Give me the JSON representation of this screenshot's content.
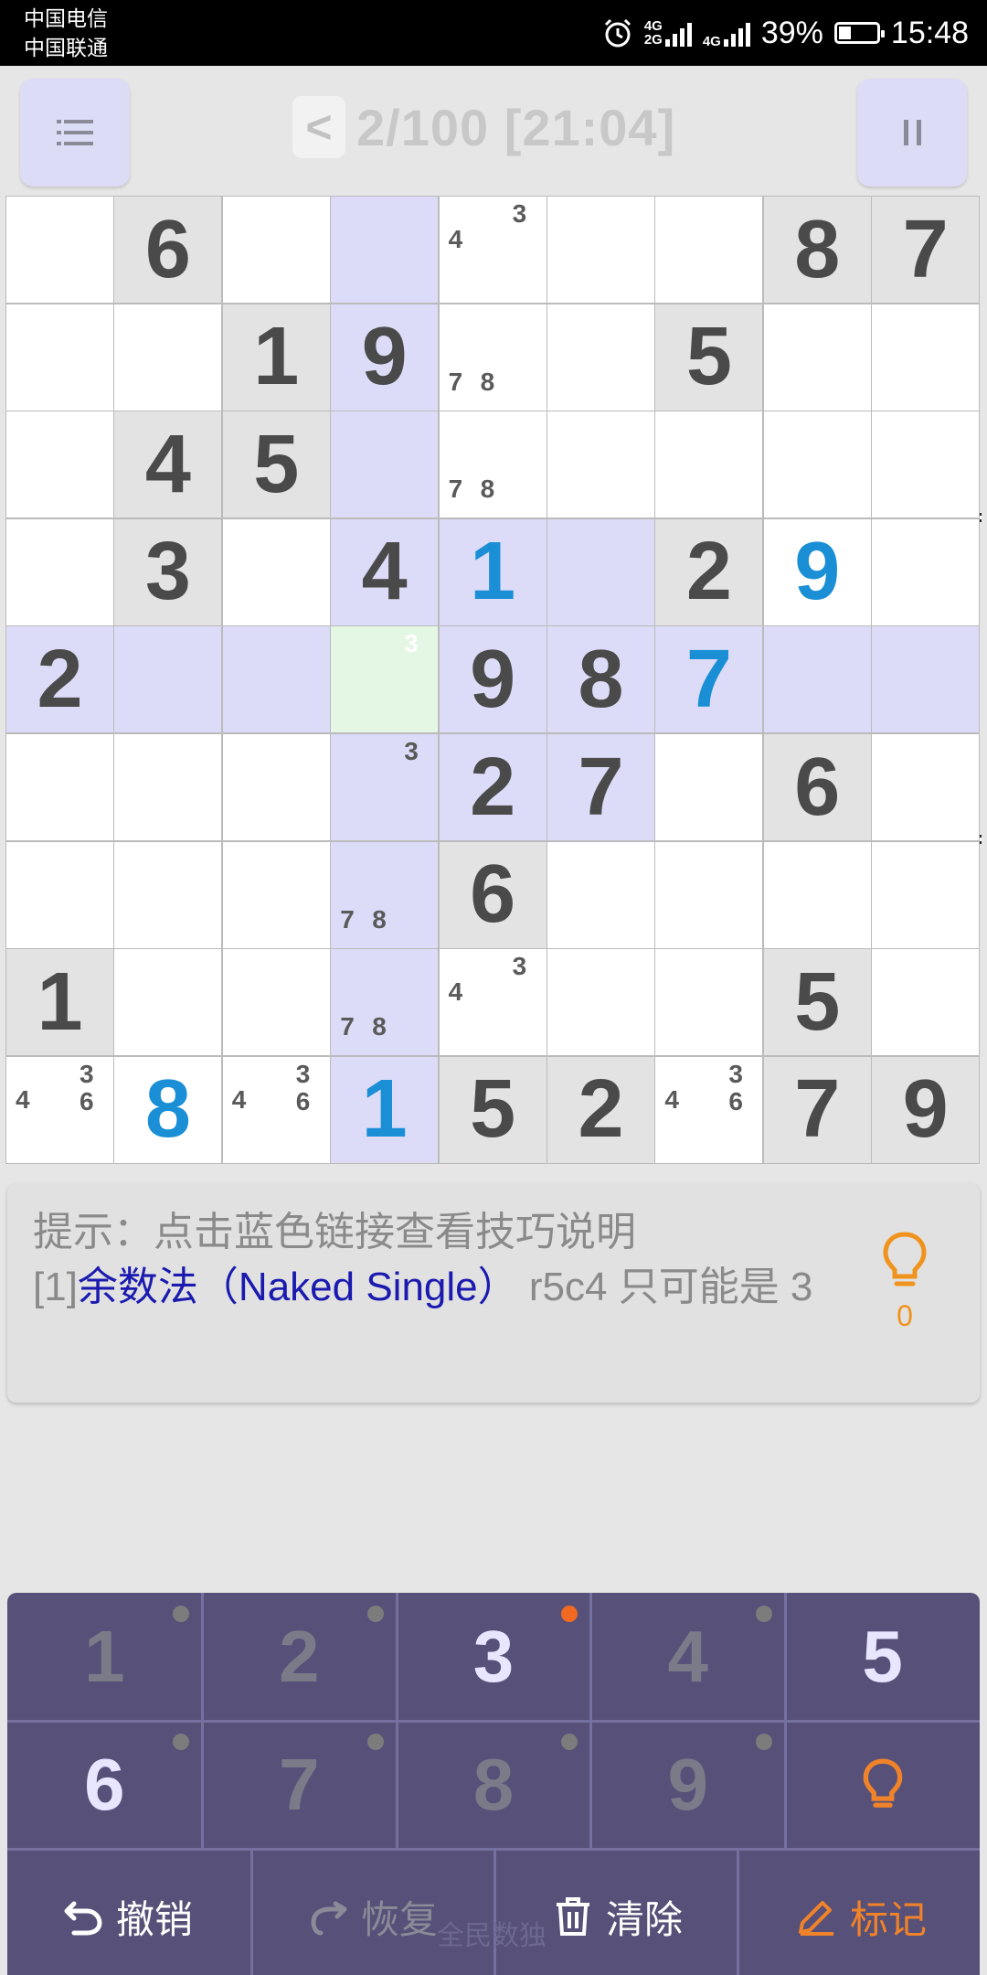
{
  "status_bar": {
    "carrier1": "中国电信",
    "carrier2": "中国联通",
    "net1": "4G",
    "net2": "2G",
    "net3": "4G",
    "battery": "39%",
    "time": "15:48"
  },
  "header": {
    "title": "2/100 [21:04]",
    "back_label": "<"
  },
  "board": {
    "cells": [
      {
        "r": 1,
        "c": 1,
        "state": "empty"
      },
      {
        "r": 1,
        "c": 2,
        "state": "given",
        "value": "6"
      },
      {
        "r": 1,
        "c": 3,
        "state": "empty"
      },
      {
        "r": 1,
        "c": 4,
        "state": "empty",
        "hl": true
      },
      {
        "r": 1,
        "c": 5,
        "state": "empty",
        "cands": [
          "3",
          "4"
        ]
      },
      {
        "r": 1,
        "c": 6,
        "state": "empty"
      },
      {
        "r": 1,
        "c": 7,
        "state": "empty"
      },
      {
        "r": 1,
        "c": 8,
        "state": "given",
        "value": "8"
      },
      {
        "r": 1,
        "c": 9,
        "state": "given",
        "value": "7"
      },
      {
        "r": 2,
        "c": 1,
        "state": "empty"
      },
      {
        "r": 2,
        "c": 2,
        "state": "empty"
      },
      {
        "r": 2,
        "c": 3,
        "state": "given",
        "value": "1"
      },
      {
        "r": 2,
        "c": 4,
        "state": "given",
        "value": "9",
        "hl": true
      },
      {
        "r": 2,
        "c": 5,
        "state": "empty",
        "cands": [
          "7",
          "8"
        ]
      },
      {
        "r": 2,
        "c": 6,
        "state": "empty"
      },
      {
        "r": 2,
        "c": 7,
        "state": "given",
        "value": "5"
      },
      {
        "r": 2,
        "c": 8,
        "state": "empty"
      },
      {
        "r": 2,
        "c": 9,
        "state": "empty"
      },
      {
        "r": 3,
        "c": 1,
        "state": "empty"
      },
      {
        "r": 3,
        "c": 2,
        "state": "given",
        "value": "4"
      },
      {
        "r": 3,
        "c": 3,
        "state": "given",
        "value": "5"
      },
      {
        "r": 3,
        "c": 4,
        "state": "empty",
        "hl": true
      },
      {
        "r": 3,
        "c": 5,
        "state": "empty",
        "cands": [
          "7",
          "8"
        ]
      },
      {
        "r": 3,
        "c": 6,
        "state": "empty"
      },
      {
        "r": 3,
        "c": 7,
        "state": "empty"
      },
      {
        "r": 3,
        "c": 8,
        "state": "empty"
      },
      {
        "r": 3,
        "c": 9,
        "state": "empty"
      },
      {
        "r": 4,
        "c": 1,
        "state": "empty"
      },
      {
        "r": 4,
        "c": 2,
        "state": "given",
        "value": "3"
      },
      {
        "r": 4,
        "c": 3,
        "state": "empty"
      },
      {
        "r": 4,
        "c": 4,
        "state": "given",
        "value": "4",
        "hl": true
      },
      {
        "r": 4,
        "c": 5,
        "state": "user",
        "value": "1",
        "hl": true
      },
      {
        "r": 4,
        "c": 6,
        "state": "empty",
        "hl": true
      },
      {
        "r": 4,
        "c": 7,
        "state": "given",
        "value": "2"
      },
      {
        "r": 4,
        "c": 8,
        "state": "user",
        "value": "9"
      },
      {
        "r": 4,
        "c": 9,
        "state": "empty"
      },
      {
        "r": 5,
        "c": 1,
        "state": "given",
        "value": "2",
        "hl": true
      },
      {
        "r": 5,
        "c": 2,
        "state": "empty",
        "hl": true
      },
      {
        "r": 5,
        "c": 3,
        "state": "empty",
        "hl": true
      },
      {
        "r": 5,
        "c": 4,
        "state": "selected",
        "cands": [
          "3"
        ]
      },
      {
        "r": 5,
        "c": 5,
        "state": "given",
        "value": "9",
        "hl": true
      },
      {
        "r": 5,
        "c": 6,
        "state": "given",
        "value": "8",
        "hl": true
      },
      {
        "r": 5,
        "c": 7,
        "state": "user",
        "value": "7",
        "hl": true
      },
      {
        "r": 5,
        "c": 8,
        "state": "empty",
        "hl": true
      },
      {
        "r": 5,
        "c": 9,
        "state": "empty",
        "hl": true
      },
      {
        "r": 6,
        "c": 1,
        "state": "empty"
      },
      {
        "r": 6,
        "c": 2,
        "state": "empty"
      },
      {
        "r": 6,
        "c": 3,
        "state": "empty"
      },
      {
        "r": 6,
        "c": 4,
        "state": "empty",
        "hl": true,
        "cands": [
          "3"
        ]
      },
      {
        "r": 6,
        "c": 5,
        "state": "given",
        "value": "2",
        "hl": true
      },
      {
        "r": 6,
        "c": 6,
        "state": "given",
        "value": "7",
        "hl": true
      },
      {
        "r": 6,
        "c": 7,
        "state": "empty"
      },
      {
        "r": 6,
        "c": 8,
        "state": "given",
        "value": "6"
      },
      {
        "r": 6,
        "c": 9,
        "state": "empty"
      },
      {
        "r": 7,
        "c": 1,
        "state": "empty"
      },
      {
        "r": 7,
        "c": 2,
        "state": "empty"
      },
      {
        "r": 7,
        "c": 3,
        "state": "empty"
      },
      {
        "r": 7,
        "c": 4,
        "state": "empty",
        "hl": true,
        "cands": [
          "7",
          "8"
        ]
      },
      {
        "r": 7,
        "c": 5,
        "state": "given",
        "value": "6"
      },
      {
        "r": 7,
        "c": 6,
        "state": "empty"
      },
      {
        "r": 7,
        "c": 7,
        "state": "empty"
      },
      {
        "r": 7,
        "c": 8,
        "state": "empty"
      },
      {
        "r": 7,
        "c": 9,
        "state": "empty"
      },
      {
        "r": 8,
        "c": 1,
        "state": "given",
        "value": "1"
      },
      {
        "r": 8,
        "c": 2,
        "state": "empty"
      },
      {
        "r": 8,
        "c": 3,
        "state": "empty"
      },
      {
        "r": 8,
        "c": 4,
        "state": "empty",
        "hl": true,
        "cands": [
          "7",
          "8"
        ]
      },
      {
        "r": 8,
        "c": 5,
        "state": "empty",
        "cands": [
          "3",
          "4"
        ]
      },
      {
        "r": 8,
        "c": 6,
        "state": "empty"
      },
      {
        "r": 8,
        "c": 7,
        "state": "empty"
      },
      {
        "r": 8,
        "c": 8,
        "state": "given",
        "value": "5"
      },
      {
        "r": 8,
        "c": 9,
        "state": "empty"
      },
      {
        "r": 9,
        "c": 1,
        "state": "empty",
        "cands": [
          "3",
          "4",
          "6"
        ]
      },
      {
        "r": 9,
        "c": 2,
        "state": "user",
        "value": "8"
      },
      {
        "r": 9,
        "c": 3,
        "state": "empty",
        "cands": [
          "3",
          "4",
          "6"
        ]
      },
      {
        "r": 9,
        "c": 4,
        "state": "user",
        "value": "1",
        "hl": true
      },
      {
        "r": 9,
        "c": 5,
        "state": "given",
        "value": "5"
      },
      {
        "r": 9,
        "c": 6,
        "state": "given",
        "value": "2"
      },
      {
        "r": 9,
        "c": 7,
        "state": "empty",
        "cands": [
          "3",
          "4",
          "6"
        ]
      },
      {
        "r": 9,
        "c": 8,
        "state": "given",
        "value": "7"
      },
      {
        "r": 9,
        "c": 9,
        "state": "given",
        "value": "9"
      }
    ]
  },
  "hint": {
    "prefix": "提示：点击蓝色链接查看技巧说明",
    "index": "[1]",
    "technique": "余数法（Naked Single）",
    "detail": " r5c4 只可能是 3",
    "count": "0"
  },
  "keypad": {
    "keys": [
      {
        "label": "1",
        "state": "dim",
        "dot": "gray"
      },
      {
        "label": "2",
        "state": "dim",
        "dot": "gray"
      },
      {
        "label": "3",
        "state": "active",
        "dot": "orange"
      },
      {
        "label": "4",
        "state": "dim",
        "dot": "gray"
      },
      {
        "label": "5",
        "state": "active",
        "dot": "none"
      },
      {
        "label": "6",
        "state": "active",
        "dot": "gray"
      },
      {
        "label": "7",
        "state": "dim",
        "dot": "gray"
      },
      {
        "label": "8",
        "state": "dim",
        "dot": "gray"
      },
      {
        "label": "9",
        "state": "dim",
        "dot": "gray"
      }
    ],
    "hint_icon": "lightbulb-icon",
    "undo_label": "撤销",
    "redo_label": "恢复",
    "clear_label": "清除",
    "mark_label": "标记",
    "watermark": "全民数独"
  },
  "colors": {
    "accent_blue": "#1a8fd6",
    "highlight": "#dcdcf8",
    "selected": "#e4f7e4",
    "keypad_bg": "#575078",
    "orange": "#f0832a"
  }
}
